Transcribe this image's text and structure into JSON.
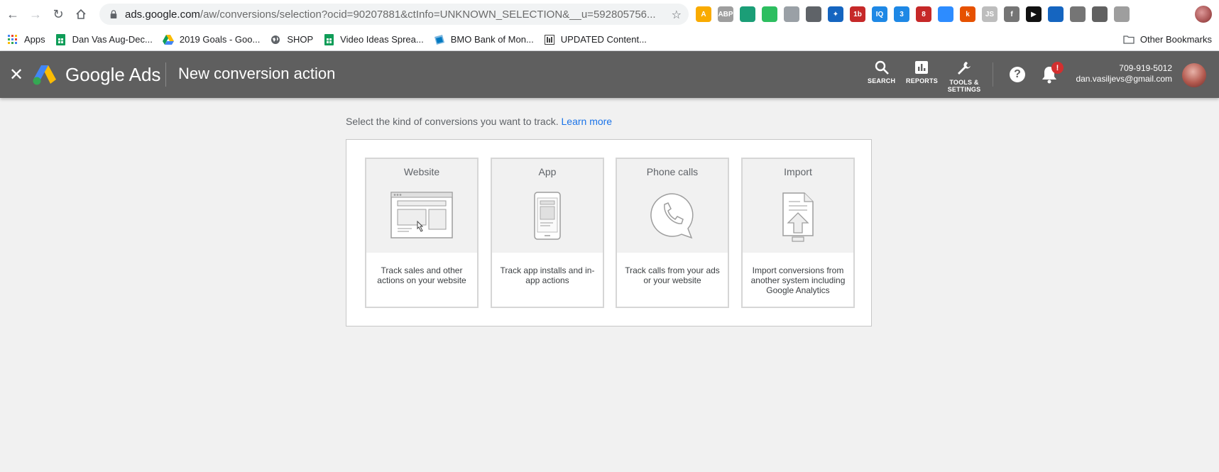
{
  "browser": {
    "url_host": "ads.google.com",
    "url_path": "/aw/conversions/selection?ocid=90207881&ctInfo=UNKNOWN_SELECTION&__u=592805756...",
    "extensions": [
      {
        "name": "a-plus-icon",
        "color": "#f9ab00",
        "glyph": "A"
      },
      {
        "name": "abp-icon",
        "color": "#9e9e9e",
        "glyph": "ABP"
      },
      {
        "name": "green-circle-icon",
        "color": "#1b9e77",
        "glyph": ""
      },
      {
        "name": "evernote-icon",
        "color": "#2dbe60",
        "glyph": ""
      },
      {
        "name": "screenshot-icon",
        "color": "#9aa0a6",
        "glyph": ""
      },
      {
        "name": "eyedropper-icon",
        "color": "#5f6368",
        "glyph": ""
      },
      {
        "name": "star-ext-icon",
        "color": "#1565c0",
        "glyph": "✦"
      },
      {
        "name": "1b-icon",
        "color": "#c62828",
        "glyph": "1b"
      },
      {
        "name": "iq-icon",
        "color": "#1e88e5",
        "glyph": "IQ"
      },
      {
        "name": "calendar-ext-icon",
        "color": "#1e88e5",
        "glyph": "3"
      },
      {
        "name": "todo-ext-icon",
        "color": "#c62828",
        "glyph": "8"
      },
      {
        "name": "zoom-ext-icon",
        "color": "#2d8cff",
        "glyph": ""
      },
      {
        "name": "k-icon",
        "color": "#e65100",
        "glyph": "k"
      },
      {
        "name": "js-icon",
        "color": "#bdbdbd",
        "glyph": "JS"
      },
      {
        "name": "facebook-ext-icon",
        "color": "#757575",
        "glyph": "f"
      },
      {
        "name": "play-ext-icon",
        "color": "#111111",
        "glyph": "▶"
      },
      {
        "name": "robot-ext-icon",
        "color": "#1565c0",
        "glyph": ""
      },
      {
        "name": "feather-ext-icon",
        "color": "#757575",
        "glyph": ""
      },
      {
        "name": "bulb-ext-icon",
        "color": "#616161",
        "glyph": ""
      },
      {
        "name": "cast-ext-icon",
        "color": "#9e9e9e",
        "glyph": ""
      }
    ]
  },
  "bookmarks": {
    "items": [
      {
        "label": "Apps",
        "icon": "apps-grid-icon",
        "color": "#4285f4"
      },
      {
        "label": "Dan Vas Aug-Dec...",
        "icon": "sheets-icon",
        "color": "#0f9d58"
      },
      {
        "label": "2019 Goals - Goo...",
        "icon": "drive-icon",
        "color": "#fbbc04"
      },
      {
        "label": "SHOP",
        "icon": "globe-icon",
        "color": "#5f6368"
      },
      {
        "label": "Video Ideas Sprea...",
        "icon": "sheets-icon",
        "color": "#0f9d58"
      },
      {
        "label": "BMO Bank of Mon...",
        "icon": "bmo-icon",
        "color": "#0079c1"
      },
      {
        "label": "UPDATED Content...",
        "icon": "doc-icon",
        "color": "#444444"
      }
    ],
    "other": "Other Bookmarks"
  },
  "header": {
    "brand": "Google Ads",
    "title": "New conversion action",
    "tools": [
      {
        "label": "SEARCH",
        "icon": "search-icon"
      },
      {
        "label": "REPORTS",
        "icon": "reports-icon"
      },
      {
        "label": "TOOLS & SETTINGS",
        "icon": "wrench-icon"
      }
    ],
    "notification_badge": "!",
    "account_phone": "709-919-5012",
    "account_email": "dan.vasiljevs@gmail.com"
  },
  "main": {
    "intro": "Select the kind of conversions you want to track.",
    "learn_more": "Learn more",
    "cards": [
      {
        "title": "Website",
        "icon": "website-illustration-icon",
        "description": "Track sales and other actions on your website"
      },
      {
        "title": "App",
        "icon": "phone-illustration-icon",
        "description": "Track app installs and in-app actions"
      },
      {
        "title": "Phone calls",
        "icon": "phone-call-illustration-icon",
        "description": "Track calls from your ads or your website"
      },
      {
        "title": "Import",
        "icon": "import-illustration-icon",
        "description": "Import conversions from another system including Google Analytics"
      }
    ]
  }
}
